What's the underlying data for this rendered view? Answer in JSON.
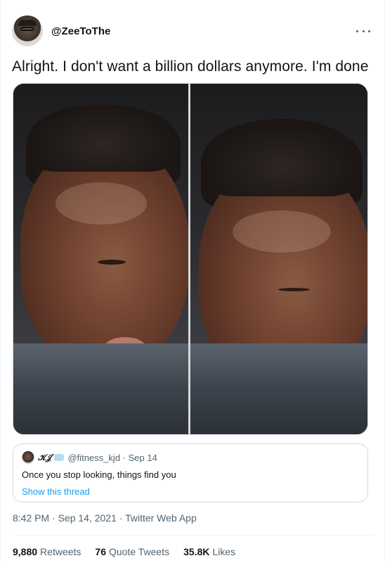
{
  "tweet": {
    "handle": "@ZeeToThe",
    "text": "Alright. I don't want a billion dollars anymore. I'm done",
    "timestamp": "8:42 PM · Sep 14, 2021 · Twitter Web App"
  },
  "quoted_tweet": {
    "name": "𝒦𝒥",
    "handle_date": "@fitness_kjd · Sep 14",
    "text": "Once you stop looking, things find you",
    "link": "Show this thread"
  },
  "stats": {
    "retweets_count": "9,880",
    "retweets_label": "Retweets",
    "quotes_count": "76",
    "quotes_label": "Quote Tweets",
    "likes_count": "35.8K",
    "likes_label": "Likes"
  },
  "icons": {
    "more": "more-horizontal-icon"
  },
  "colors": {
    "link": "#1d9bf0",
    "muted": "#536471",
    "text": "#0f1419",
    "border": "#cfd9de"
  }
}
